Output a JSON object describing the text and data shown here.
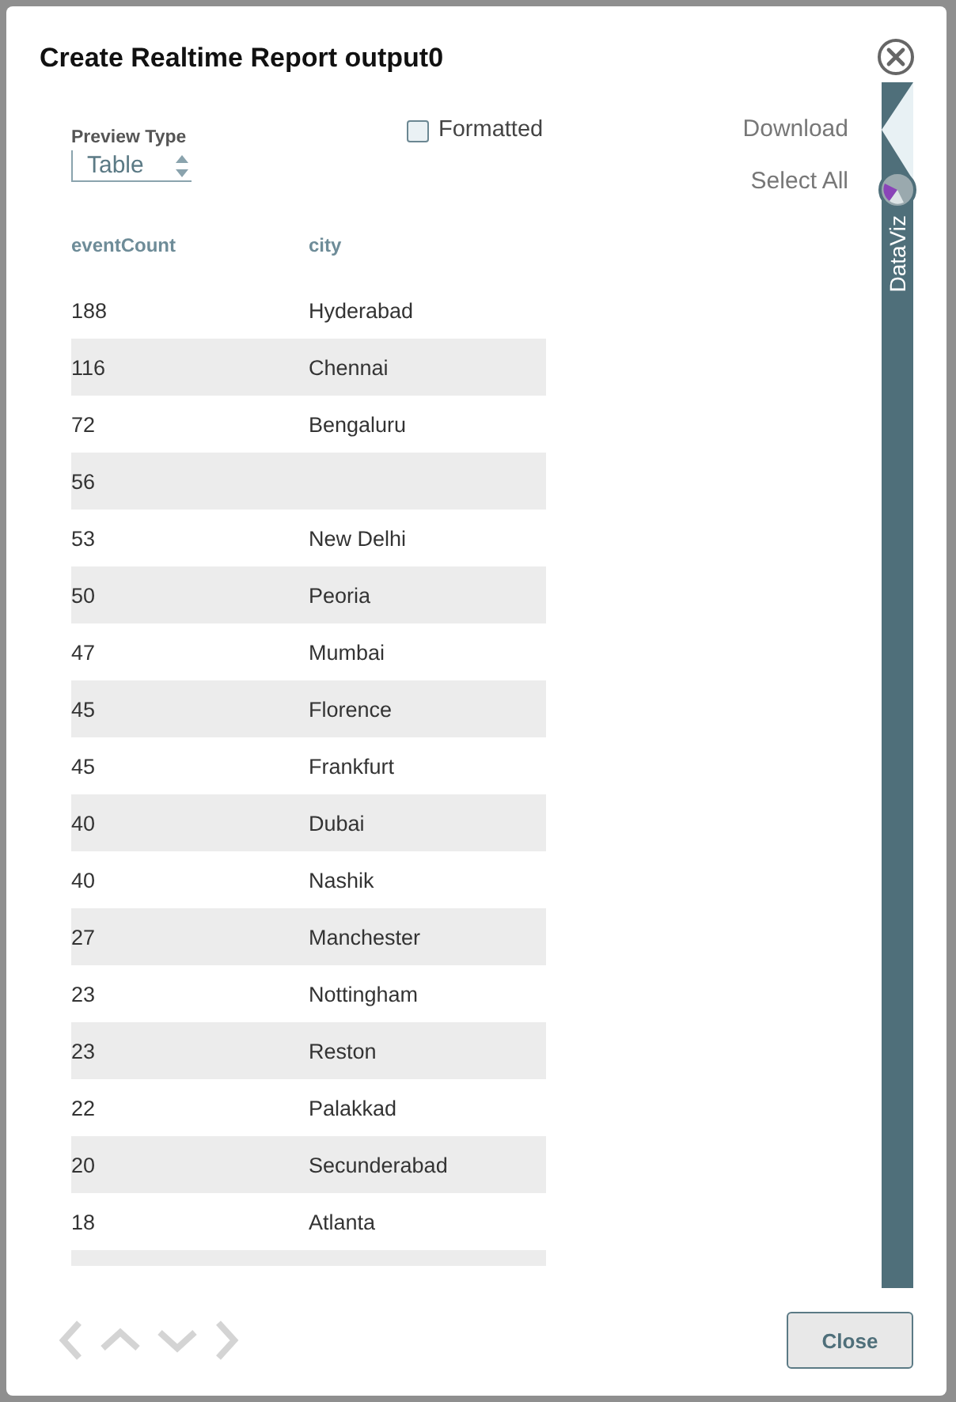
{
  "dialog": {
    "title": "Create Realtime Report output0"
  },
  "preview_type": {
    "label": "Preview Type",
    "value": "Table"
  },
  "formatted": {
    "label": "Formatted",
    "checked": false
  },
  "actions": [
    "Download",
    "Select All"
  ],
  "sidebar": {
    "label": "DataViz"
  },
  "table": {
    "columns": [
      "eventCount",
      "city"
    ],
    "rows": [
      [
        "188",
        "Hyderabad"
      ],
      [
        "116",
        "Chennai"
      ],
      [
        "72",
        "Bengaluru"
      ],
      [
        "56",
        ""
      ],
      [
        "53",
        "New Delhi"
      ],
      [
        "50",
        "Peoria"
      ],
      [
        "47",
        "Mumbai"
      ],
      [
        "45",
        "Florence"
      ],
      [
        "45",
        "Frankfurt"
      ],
      [
        "40",
        "Dubai"
      ],
      [
        "40",
        "Nashik"
      ],
      [
        "27",
        "Manchester"
      ],
      [
        "23",
        "Nottingham"
      ],
      [
        "23",
        "Reston"
      ],
      [
        "22",
        "Palakkad"
      ],
      [
        "20",
        "Secunderabad"
      ],
      [
        "18",
        "Atlanta"
      ]
    ]
  },
  "footer": {
    "close_button": "Close"
  }
}
